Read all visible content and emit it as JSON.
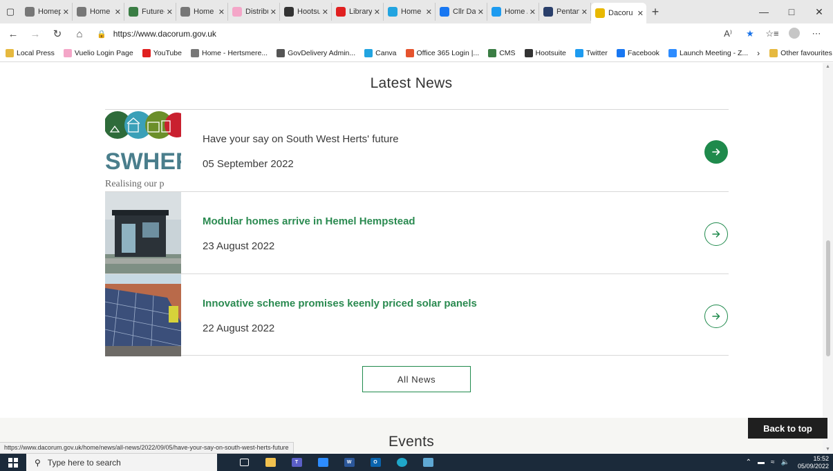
{
  "browser": {
    "tabs": [
      {
        "label": "Homep",
        "icon": "page-icon",
        "color": "#777777"
      },
      {
        "label": "Home -",
        "icon": "page-icon",
        "color": "#777777"
      },
      {
        "label": "Future-",
        "icon": "cms-icon",
        "color": "#3a7d44"
      },
      {
        "label": "Home -",
        "icon": "page-icon",
        "color": "#777777"
      },
      {
        "label": "Distribu",
        "icon": "vuelio-icon",
        "color": "#f4a6c8"
      },
      {
        "label": "Hootsu",
        "icon": "hootsuite-icon",
        "color": "#333333"
      },
      {
        "label": "Library",
        "icon": "youtube-icon",
        "color": "#e02020"
      },
      {
        "label": "Home",
        "icon": "canva-icon",
        "color": "#22a4e0"
      },
      {
        "label": "Cllr Dar",
        "icon": "facebook-icon",
        "color": "#1877f2"
      },
      {
        "label": "Home /",
        "icon": "twitter-icon",
        "color": "#1d9bf0"
      },
      {
        "label": "Pentan",
        "icon": "pentana-icon",
        "color": "#2a3f6b"
      },
      {
        "label": "Dacoru",
        "icon": "dacorum-icon",
        "color": "#e8b800",
        "active": true
      }
    ],
    "url": "https://www.dacorum.gov.uk",
    "bookmarks": [
      {
        "label": "Local Press",
        "icon": "folder-icon",
        "color": "#e6b93f"
      },
      {
        "label": "Vuelio Login Page",
        "icon": "vuelio-icon",
        "color": "#f4a6c8"
      },
      {
        "label": "YouTube",
        "icon": "youtube-icon",
        "color": "#e02020"
      },
      {
        "label": "Home - Hertsmere...",
        "icon": "page-icon",
        "color": "#777777"
      },
      {
        "label": "GovDelivery Admin...",
        "icon": "govdelivery-icon",
        "color": "#555555"
      },
      {
        "label": "Canva",
        "icon": "canva-icon",
        "color": "#22a4e0"
      },
      {
        "label": "Office 365 Login |...",
        "icon": "office-icon",
        "color": "#e5532d"
      },
      {
        "label": "CMS",
        "icon": "cms-icon",
        "color": "#3a7d44"
      },
      {
        "label": "Hootsuite",
        "icon": "hootsuite-icon",
        "color": "#333333"
      },
      {
        "label": "Twitter",
        "icon": "twitter-icon",
        "color": "#1d9bf0"
      },
      {
        "label": "Facebook",
        "icon": "facebook-icon",
        "color": "#1877f2"
      },
      {
        "label": "Launch Meeting - Z...",
        "icon": "zoom-icon",
        "color": "#2d8cff"
      }
    ],
    "other_favourites": "Other favourites",
    "status_url": "https://www.dacorum.gov.uk/home/news/all-news/2022/09/05/have-your-say-on-south-west-herts-future"
  },
  "page": {
    "latest_news_title": "Latest News",
    "news": [
      {
        "headline": "Have your say on South West Herts' future",
        "date": "05 September 2022",
        "thumb_text": "SWHEF",
        "thumb_sub": "Realising our p"
      },
      {
        "headline": "Modular homes arrive in Hemel Hempstead",
        "date": "23 August 2022"
      },
      {
        "headline": "Innovative scheme promises keenly priced solar panels",
        "date": "22 August 2022"
      }
    ],
    "all_news_label": "All News",
    "events_title": "Events",
    "back_to_top_label": "Back to top",
    "accent_color": "#1f8a4c"
  },
  "taskbar": {
    "search_placeholder": "Type here to search",
    "time": "15:52",
    "date": "05/09/2022"
  }
}
